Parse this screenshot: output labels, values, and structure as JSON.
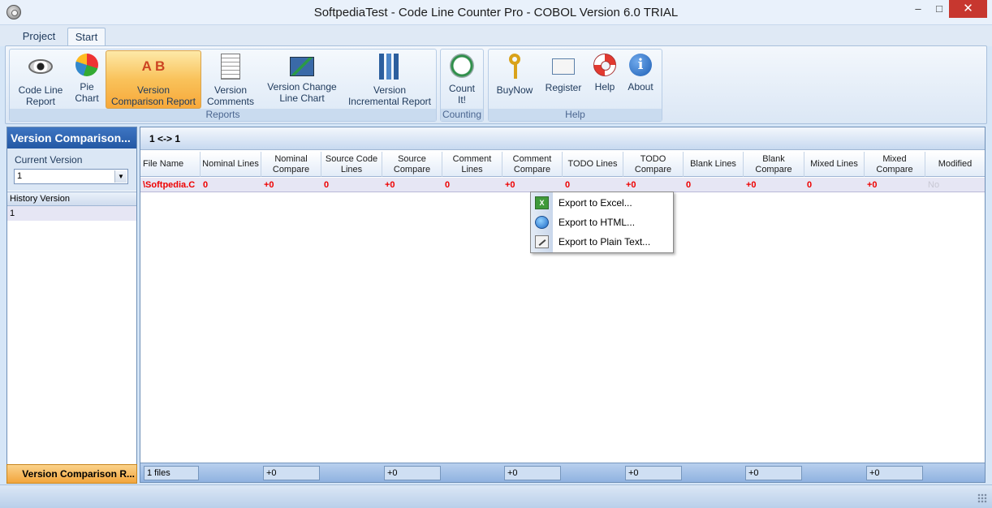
{
  "window": {
    "title": "SoftpediaTest - Code Line Counter Pro - COBOL Version 6.0 TRIAL",
    "minimize": "–",
    "maximize": "□",
    "close": "✕"
  },
  "ribbon_tabs": [
    {
      "label": "Project"
    },
    {
      "label": "Start"
    }
  ],
  "ribbon": {
    "groups": [
      {
        "label": "Reports",
        "buttons": [
          {
            "line1": "Code Line",
            "line2": "Report",
            "icon": "eye-icon"
          },
          {
            "line1": "Pie",
            "line2": "Chart",
            "icon": "pie-chart-icon"
          },
          {
            "line1": "Version",
            "line2": "Comparison Report",
            "icon": "ab-compare-icon"
          },
          {
            "line1": "Version",
            "line2": "Comments",
            "icon": "notepad-icon"
          },
          {
            "line1": "Version Change",
            "line2": "Line Chart",
            "icon": "line-chart-icon"
          },
          {
            "line1": "Version",
            "line2": "Incremental Report",
            "icon": "bar-chart-icon"
          }
        ]
      },
      {
        "label": "Counting",
        "buttons": [
          {
            "line1": "Count",
            "line2": "It!",
            "icon": "clock-icon"
          }
        ]
      },
      {
        "label": "Help",
        "buttons": [
          {
            "line1": "BuyNow",
            "line2": "",
            "icon": "key-icon"
          },
          {
            "line1": "Register",
            "line2": "",
            "icon": "envelope-icon"
          },
          {
            "line1": "Help",
            "line2": "",
            "icon": "lifebuoy-icon"
          },
          {
            "line1": "About",
            "line2": "",
            "icon": "info-icon"
          }
        ]
      }
    ],
    "ab_glyph": "A B",
    "info_glyph": "i"
  },
  "left_panel": {
    "title": "Version Comparison...",
    "current_version_label": "Current Version",
    "current_version_value": "1",
    "history_header": "History Version",
    "history_items": [
      "1"
    ],
    "footer": "Version Comparison R..."
  },
  "main_panel": {
    "header": "1 <-> 1",
    "columns": [
      "File Name",
      "Nominal Lines",
      "Nominal Compare",
      "Source Code Lines",
      "Source Compare",
      "Comment Lines",
      "Comment Compare",
      "TODO Lines",
      "TODO Compare",
      "Blank Lines",
      "Blank Compare",
      "Mixed Lines",
      "Mixed Compare",
      "Modified"
    ],
    "rows": [
      [
        "\\Softpedia.C",
        "0",
        "+0",
        "0",
        "+0",
        "0",
        "+0",
        "0",
        "+0",
        "0",
        "+0",
        "0",
        "+0",
        "No"
      ]
    ],
    "footer": {
      "files": "1 files",
      "nominal": "+0",
      "source": "+0",
      "comment": "+0",
      "todo": "+0",
      "blank": "+0",
      "mixed": "+0"
    }
  },
  "context_menu": {
    "items": [
      {
        "label": "Export to Excel...",
        "icon": "excel-icon"
      },
      {
        "label": "Export to HTML...",
        "icon": "globe-icon"
      },
      {
        "label": "Export to Plain Text...",
        "icon": "text-file-icon"
      }
    ],
    "excel_glyph": "X"
  },
  "colors": {
    "accent": "#2458a4",
    "active_button": "#f9c25a",
    "diff_text": "#e00000"
  }
}
